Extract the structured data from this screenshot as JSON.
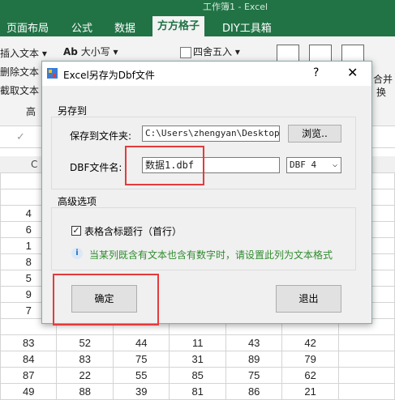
{
  "window": {
    "title": "工作簿1 - Excel"
  },
  "ribbon": {
    "tabs": [
      "页面布局",
      "公式",
      "数据",
      "方方格子",
      "DIY工具箱"
    ],
    "active_tab": "方方格子",
    "items": {
      "insert_text": "插入文本",
      "delete_text": "删除文本",
      "extract_text": "截取文本",
      "case": "大小写",
      "round": "四舍五入",
      "merge": "合并",
      "swap": "换",
      "group_label": "高"
    }
  },
  "sheet": {
    "col_header_partial": "C",
    "rows": [
      [
        "",
        "",
        "",
        "",
        "",
        "",
        ""
      ],
      [
        "",
        "",
        "",
        "",
        "",
        "",
        ""
      ],
      [
        "4",
        "",
        "",
        "",
        "",
        "",
        ""
      ],
      [
        "6",
        "",
        "",
        "",
        "",
        "",
        ""
      ],
      [
        "1",
        "",
        "",
        "",
        "",
        "",
        ""
      ],
      [
        "8",
        "",
        "",
        "",
        "",
        "",
        ""
      ],
      [
        "5",
        "",
        "",
        "",
        "",
        "",
        ""
      ],
      [
        "9",
        "",
        "",
        "",
        "",
        "",
        ""
      ],
      [
        "7",
        "",
        "",
        "",
        "",
        "",
        ""
      ],
      [
        "",
        "",
        "",
        "",
        "",
        "",
        ""
      ],
      [
        "83",
        "52",
        "44",
        "11",
        "43",
        "42",
        ""
      ],
      [
        "84",
        "83",
        "75",
        "31",
        "89",
        "79",
        ""
      ],
      [
        "87",
        "22",
        "55",
        "85",
        "75",
        "62",
        ""
      ],
      [
        "49",
        "88",
        "39",
        "81",
        "86",
        "21",
        ""
      ]
    ]
  },
  "dialog": {
    "title": "Excel另存为Dbf文件",
    "help": "?",
    "close": "✕",
    "save_group": {
      "title": "另存到",
      "folder_label": "保存到文件夹:",
      "folder_value": "C:\\Users\\zhengyan\\Desktop",
      "browse_label": "浏览..",
      "filename_label": "DBF文件名:",
      "filename_value": "数据1.dbf",
      "format_value": "DBF 4"
    },
    "advanced_group": {
      "title": "高级选项",
      "checkbox_label": "表格含标题行（首行）",
      "checkbox_checked": true,
      "note": "当某列既含有文本也含有数字时，请设置此列为文本格式"
    },
    "ok_label": "确定",
    "exit_label": "退出"
  },
  "colors": {
    "excel_green": "#217346",
    "highlight_red": "#e53b3b",
    "note_green": "#2e8b2e"
  }
}
